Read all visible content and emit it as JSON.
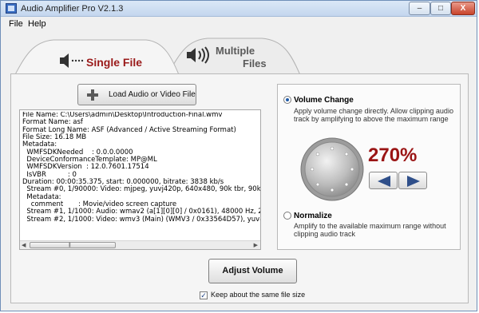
{
  "window": {
    "title": "Audio Amplifier Pro V2.1.3"
  },
  "titlebar_buttons": {
    "minimize": "–",
    "maximize": "□",
    "close": "X"
  },
  "menu": {
    "file": "File",
    "help": "Help"
  },
  "tabs": {
    "single": "Single File",
    "multiple_line1": "Multiple",
    "multiple_line2": "Files"
  },
  "load_button": "Load Audio or Video File",
  "file_info": [
    "File Name: C:\\Users\\admin\\Desktop\\Introduction-Final.wmv",
    "Format Name: asf",
    "Format Long Name: ASF (Advanced / Active Streaming Format)",
    "File Size: 16.18 MB",
    "Metadata:",
    "  WMFSDKNeeded    : 0.0.0.0000",
    "  DeviceConformanceTemplate: MP@ML",
    "  WMFSDKVersion  : 12.0.7601.17514",
    "  IsVBR          : 0",
    "Duration: 00:00:35.375, start: 0.000000, bitrate: 3838 kb/s",
    "  Stream #0, 1/90000: Video: mjpeg, yuvj420p, 640x480, 90k tbr, 90k tb",
    "  Metadata:",
    "    comment       : Movie/video screen capture",
    "  Stream #1, 1/1000: Audio: wmav2 (a[1][0][0] / 0x0161), 48000 Hz, 2 c",
    "  Stream #2, 1/1000: Video: wmv3 (Main) (WMV3 / 0x33564D57), yuv420"
  ],
  "volume_change": {
    "title": "Volume Change",
    "description": "Apply volume change directly. Allow clipping audio track by amplifying to above the maximum range",
    "percent": "270%"
  },
  "normalize": {
    "title": "Normalize",
    "description": "Amplify to the available maximum range without clipping audio track"
  },
  "adjust_button": "Adjust Volume",
  "keep_size": {
    "label": "Keep about the same file size",
    "checked": true
  },
  "colors": {
    "accent_red": "#9a1414",
    "title_grad_top": "#dbe8f7"
  }
}
